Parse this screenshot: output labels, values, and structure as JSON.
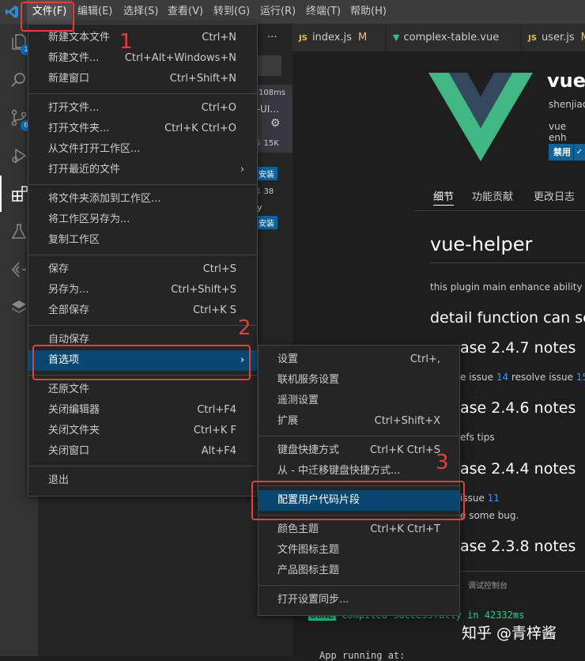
{
  "menubar": {
    "items": [
      "文件(F)",
      "编辑(E)",
      "选择(S)",
      "查看(V)",
      "转到(G)",
      "运行(R)",
      "终端(T)",
      "帮助(H)"
    ]
  },
  "activity_badges": {
    "explorer": "1",
    "scm": "6"
  },
  "sidebar": {
    "header_dots": "···",
    "ext1_time": "108ms",
    "ext1_name_frag": "t-UI...",
    "ext1_downloads": "15K",
    "ext1_install": "安装",
    "ext2_downloads": "38",
    "ext2_frag": "ly",
    "ext2_install": "安装"
  },
  "tabs": [
    {
      "icon": "JS",
      "label": "index.js",
      "modified": "M"
    },
    {
      "icon": "vue",
      "label": "complex-table.vue",
      "modified": ""
    },
    {
      "icon": "JS",
      "label": "user.js",
      "modified": "M"
    }
  ],
  "extension": {
    "name": "vue-",
    "author": "shenjiao",
    "desc": "vue enh",
    "disabled_label": "禁用",
    "tabs": [
      "细节",
      "功能贡献",
      "更改日志"
    ]
  },
  "readme": {
    "title": "vue-helper",
    "intro": "this plugin main enhance ability fo",
    "detail_heading": "detail function can see",
    "h_247": "ase 2.4.7 notes",
    "issue_line_pre": "e issue ",
    "issue_14": "14",
    "issue_line_mid": " resolve issue ",
    "issue_15": "15",
    "issue_line_post": " re",
    "h_246": "ase 2.4.6 notes",
    "refs_line": "efs tips",
    "h_244": "ase 2.4.4 notes",
    "issue11_pre": "issue ",
    "issue_11": "11",
    "bug_line": "e some bug.",
    "h_238": "ase 2.3.8 notes"
  },
  "panel": {
    "tab": "调试控制台",
    "done": "DONE",
    "compiled": "Compiled successfully in 42332ms",
    "running": "App running at:"
  },
  "watermark": "知乎 @青梓酱",
  "file_menu": {
    "groups": [
      [
        {
          "label": "新建文本文件",
          "kb": "Ctrl+N"
        },
        {
          "label": "新建文件...",
          "kb": "Ctrl+Alt+Windows+N"
        },
        {
          "label": "新建窗口",
          "kb": "Ctrl+Shift+N"
        }
      ],
      [
        {
          "label": "打开文件...",
          "kb": "Ctrl+O"
        },
        {
          "label": "打开文件夹...",
          "kb": "Ctrl+K Ctrl+O"
        },
        {
          "label": "从文件打开工作区...",
          "kb": ""
        },
        {
          "label": "打开最近的文件",
          "kb": ""
        }
      ],
      [
        {
          "label": "将文件夹添加到工作区...",
          "kb": ""
        },
        {
          "label": "将工作区另存为...",
          "kb": ""
        },
        {
          "label": "复制工作区",
          "kb": ""
        }
      ],
      [
        {
          "label": "保存",
          "kb": "Ctrl+S"
        },
        {
          "label": "另存为...",
          "kb": "Ctrl+Shift+S"
        },
        {
          "label": "全部保存",
          "kb": "Ctrl+K S"
        }
      ],
      [
        {
          "label": "自动保存",
          "kb": ""
        },
        {
          "label": "首选项",
          "kb": ""
        }
      ],
      [
        {
          "label": "还原文件",
          "kb": ""
        },
        {
          "label": "关闭编辑器",
          "kb": "Ctrl+F4"
        },
        {
          "label": "关闭文件夹",
          "kb": "Ctrl+K F"
        },
        {
          "label": "关闭窗口",
          "kb": "Alt+F4"
        }
      ],
      [
        {
          "label": "退出",
          "kb": ""
        }
      ]
    ]
  },
  "prefs_menu": {
    "groups": [
      [
        {
          "label": "设置",
          "kb": "Ctrl+,"
        },
        {
          "label": "联机服务设置",
          "kb": ""
        },
        {
          "label": "遥测设置",
          "kb": ""
        },
        {
          "label": "扩展",
          "kb": "Ctrl+Shift+X"
        }
      ],
      [
        {
          "label": "键盘快捷方式",
          "kb": "Ctrl+K Ctrl+S"
        },
        {
          "label": "从 - 中迁移键盘快捷方式...",
          "kb": ""
        }
      ],
      [
        {
          "label": "配置用户代码片段",
          "kb": ""
        }
      ],
      [
        {
          "label": "颜色主题",
          "kb": "Ctrl+K Ctrl+T"
        },
        {
          "label": "文件图标主题",
          "kb": ""
        },
        {
          "label": "产品图标主题",
          "kb": ""
        }
      ],
      [
        {
          "label": "打开设置同步...",
          "kb": ""
        }
      ]
    ]
  },
  "annotations": [
    "1",
    "2",
    "3"
  ],
  "colors": {
    "highlight": "#094771",
    "annotation": "#e2403a",
    "vue_green": "#41b883",
    "vue_dark": "#35495e"
  }
}
